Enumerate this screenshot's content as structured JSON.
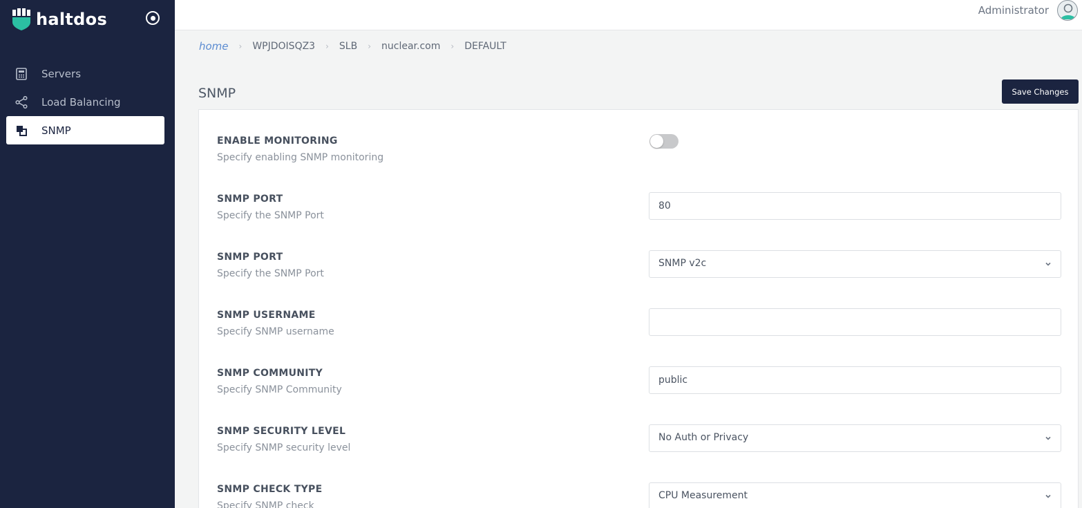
{
  "app": {
    "brand": "haltdos"
  },
  "sidebar": {
    "items": [
      {
        "label": "Servers",
        "icon": "calculator-icon",
        "active": false
      },
      {
        "label": "Load Balancing",
        "icon": "share-icon",
        "active": false
      },
      {
        "label": "SNMP",
        "icon": "layers-icon",
        "active": true
      }
    ]
  },
  "topbar": {
    "user": "Administrator"
  },
  "breadcrumb": [
    "home",
    "WPJDOISQZ3",
    "SLB",
    "nuclear.com",
    "DEFAULT"
  ],
  "page": {
    "title": "SNMP",
    "save_label": "Save Changes"
  },
  "fields": [
    {
      "label": "ENABLE MONITORING",
      "desc": "Specify enabling SNMP monitoring",
      "type": "toggle",
      "value": false
    },
    {
      "label": "SNMP PORT",
      "desc": "Specify the SNMP Port",
      "type": "input",
      "value": "80"
    },
    {
      "label": "SNMP PORT",
      "desc": "Specify the SNMP Port",
      "type": "select",
      "value": "SNMP v2c"
    },
    {
      "label": "SNMP USERNAME",
      "desc": "Specify SNMP username",
      "type": "input",
      "value": ""
    },
    {
      "label": "SNMP COMMUNITY",
      "desc": "Specify SNMP Community",
      "type": "input",
      "value": "public"
    },
    {
      "label": "SNMP SECURITY LEVEL",
      "desc": "Specify SNMP security level",
      "type": "select",
      "value": "No Auth or Privacy"
    },
    {
      "label": "SNMP CHECK TYPE",
      "desc": "Specify SNMP check",
      "type": "select",
      "value": "CPU Measurement"
    }
  ],
  "colors": {
    "sidebar_bg": "#1b2440",
    "accent": "#5b8bd1",
    "logo_teal": "#2bbfa3"
  }
}
